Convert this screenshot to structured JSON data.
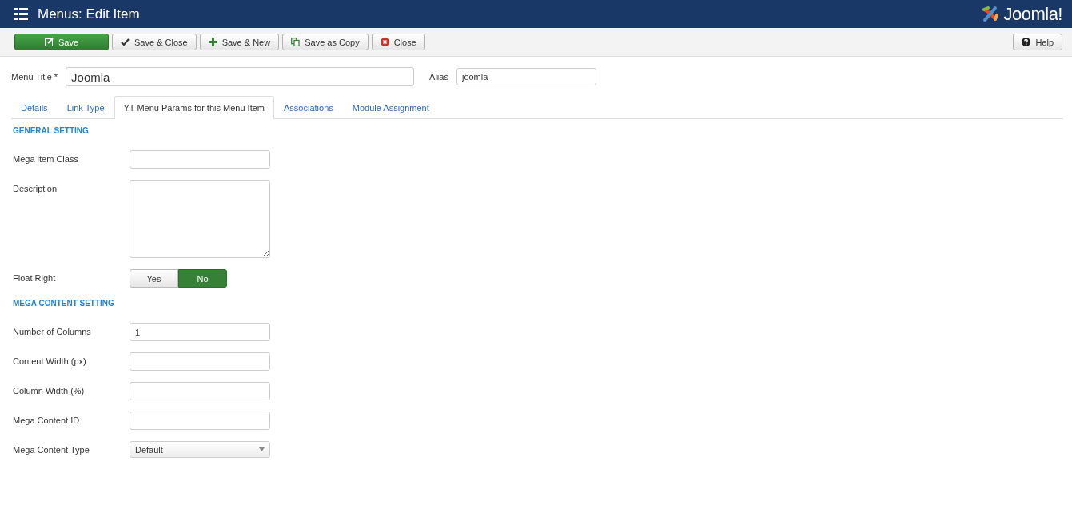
{
  "header": {
    "title": "Menus: Edit Item",
    "logo_text": "Joomla!"
  },
  "toolbar": {
    "buttons": [
      {
        "label": "Save",
        "kind": "primary"
      },
      {
        "label": "Save & Close",
        "kind": "default"
      },
      {
        "label": "Save & New",
        "kind": "default"
      },
      {
        "label": "Save as Copy",
        "kind": "default"
      },
      {
        "label": "Close",
        "kind": "default"
      }
    ],
    "help": {
      "label": "Help"
    }
  },
  "title_field": {
    "label": "Menu Title *",
    "value": "Joomla"
  },
  "alias_field": {
    "label": "Alias",
    "value": "joomla"
  },
  "tabs": [
    {
      "label": "Details",
      "selected": false
    },
    {
      "label": "Link Type",
      "selected": false
    },
    {
      "label": "YT Menu Params for this Menu Item",
      "selected": true
    },
    {
      "label": "Associations",
      "selected": false
    },
    {
      "label": "Module Assignment",
      "selected": false
    }
  ],
  "sections": [
    {
      "heading": "GENERAL SETTING",
      "fields": [
        {
          "label": "Mega item Class",
          "kind": "text"
        },
        {
          "label": "Description",
          "kind": "textarea"
        },
        {
          "label": "Float Right",
          "kind": "toggle",
          "options": [
            {
              "label": "Yes",
              "selected": false
            },
            {
              "label": "No",
              "selected": true
            }
          ]
        }
      ]
    },
    {
      "heading": "MEGA CONTENT SETTING",
      "fields": [
        {
          "label": "Number of Columns",
          "kind": "text",
          "value": "1"
        },
        {
          "label": "Content Width (px)",
          "kind": "text"
        },
        {
          "label": "Column Width (%)",
          "kind": "text"
        },
        {
          "label": "Mega Content ID",
          "kind": "text"
        },
        {
          "label": "Mega Content Type",
          "kind": "select",
          "value": "Default"
        }
      ]
    }
  ]
}
